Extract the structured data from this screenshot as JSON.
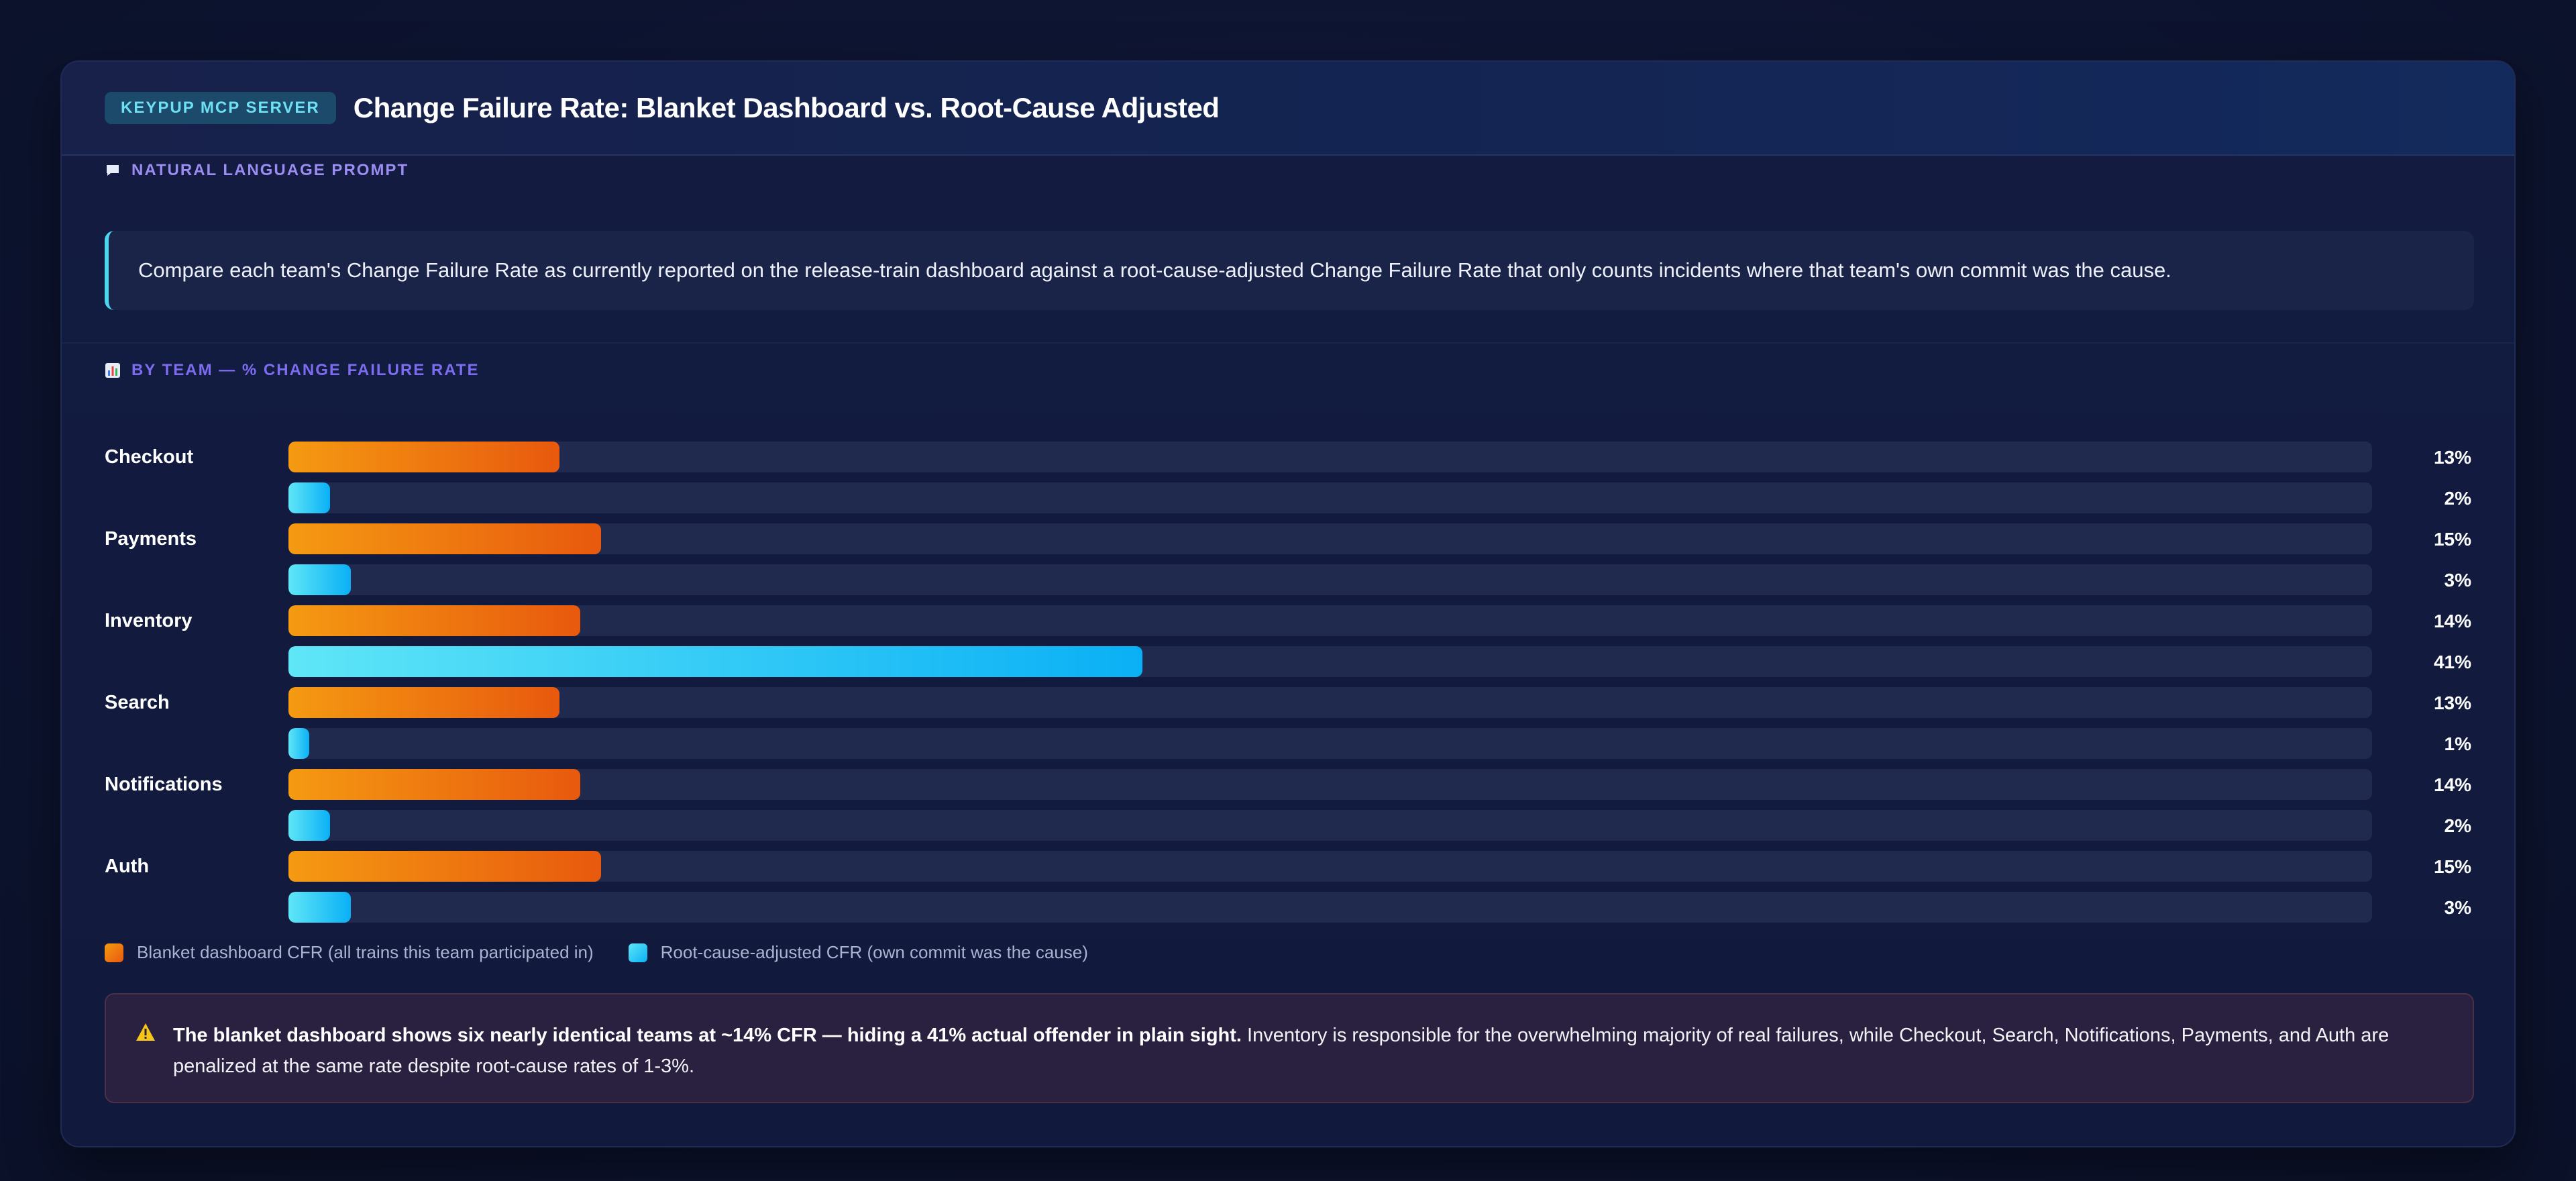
{
  "header": {
    "badge": "KEYPUP MCP SERVER",
    "title": "Change Failure Rate: Blanket Dashboard vs. Root-Cause Adjusted"
  },
  "prompt": {
    "label": "NATURAL LANGUAGE PROMPT",
    "icon": "speech-bubble-icon",
    "text": "Compare each team's Change Failure Rate as currently reported on the release-train dashboard against a root-cause-adjusted Change Failure Rate that only counts incidents where that team's own commit was the cause."
  },
  "chart_section": {
    "label": "BY TEAM — % CHANGE FAILURE RATE",
    "icon": "bar-chart-icon"
  },
  "chart_data": {
    "type": "bar",
    "orientation": "horizontal",
    "categories": [
      "Checkout",
      "Payments",
      "Inventory",
      "Search",
      "Notifications",
      "Auth"
    ],
    "series": [
      {
        "name": "Blanket dashboard CFR (all trains this team participated in)",
        "values": [
          13,
          15,
          14,
          13,
          14,
          15
        ],
        "labels": [
          "13%",
          "15%",
          "14%",
          "13%",
          "14%",
          "15%"
        ],
        "color": "#f2840f"
      },
      {
        "name": "Root-cause-adjusted CFR (own commit was the cause)",
        "values": [
          2,
          3,
          41,
          1,
          2,
          3
        ],
        "labels": [
          "2%",
          "3%",
          "41%",
          "1%",
          "2%",
          "3%"
        ],
        "color": "#22c3f5"
      }
    ],
    "xlim": [
      0,
      100
    ],
    "unit": "%",
    "legend_position": "bottom-left"
  },
  "callout": {
    "icon": "warning-icon",
    "bold": "The blanket dashboard shows six nearly identical teams at ~14% CFR — hiding a 41% actual offender in plain sight.",
    "text": " Inventory is responsible for the overwhelming majority of real failures, while Checkout, Search, Notifications, Payments, and Auth are penalized at the same rate despite root-cause rates of 1-3%."
  }
}
